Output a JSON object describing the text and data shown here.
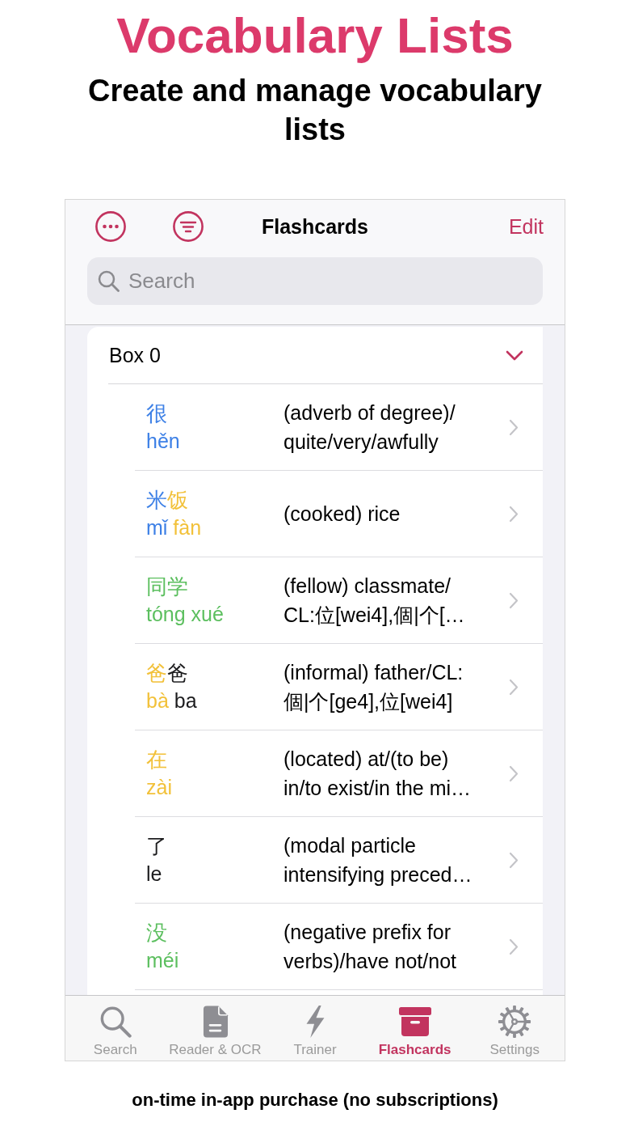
{
  "header": {
    "title": "Vocabulary Lists",
    "subtitle": "Create and manage vocabulary lists"
  },
  "nav_bar": {
    "title": "Flashcards",
    "action": "Edit"
  },
  "search": {
    "placeholder": "Search"
  },
  "section": {
    "title": "Box 0",
    "expanded": true
  },
  "words": [
    {
      "syllables": [
        {
          "hanzi": "很",
          "pinyin": "hěn",
          "color": "#3d80e6"
        }
      ],
      "definition": [
        "(adverb of degree)/",
        "quite/very/awfully"
      ]
    },
    {
      "syllables": [
        {
          "hanzi": "米",
          "pinyin": "mǐ",
          "color": "#3d80e6"
        },
        {
          "hanzi": "饭",
          "pinyin": "fàn",
          "color": "#f2c13a"
        }
      ],
      "definition": [
        "(cooked) rice"
      ]
    },
    {
      "syllables": [
        {
          "hanzi": "同",
          "pinyin": "tóng",
          "color": "#5cbf5f"
        },
        {
          "hanzi": "学",
          "pinyin": "xué",
          "color": "#5cbf5f"
        }
      ],
      "definition": [
        "(fellow) classmate/",
        "CL:位[wei4],個|个[…"
      ]
    },
    {
      "syllables": [
        {
          "hanzi": "爸",
          "pinyin": "bà",
          "color": "#f2c13a"
        },
        {
          "hanzi": "爸",
          "pinyin": "ba",
          "color": "#1c1c1e"
        }
      ],
      "definition": [
        "(informal) father/CL:",
        "個|个[ge4],位[wei4]"
      ]
    },
    {
      "syllables": [
        {
          "hanzi": "在",
          "pinyin": "zài",
          "color": "#f2c13a"
        }
      ],
      "definition": [
        "(located) at/(to be)",
        "in/to exist/in the mi…"
      ]
    },
    {
      "syllables": [
        {
          "hanzi": "了",
          "pinyin": "le",
          "color": "#1c1c1e"
        }
      ],
      "definition": [
        "(modal particle",
        "intensifying preced…"
      ]
    },
    {
      "syllables": [
        {
          "hanzi": "没",
          "pinyin": "méi",
          "color": "#5cbf5f"
        }
      ],
      "definition": [
        "(negative prefix for",
        "verbs)/have not/not"
      ]
    }
  ],
  "tabs": [
    {
      "label": "Search",
      "selected": false
    },
    {
      "label": "Reader & OCR",
      "selected": false
    },
    {
      "label": "Trainer",
      "selected": false
    },
    {
      "label": "Flashcards",
      "selected": true
    },
    {
      "label": "Settings",
      "selected": false
    }
  ],
  "footer": "on-time in-app purchase (no subscriptions)"
}
